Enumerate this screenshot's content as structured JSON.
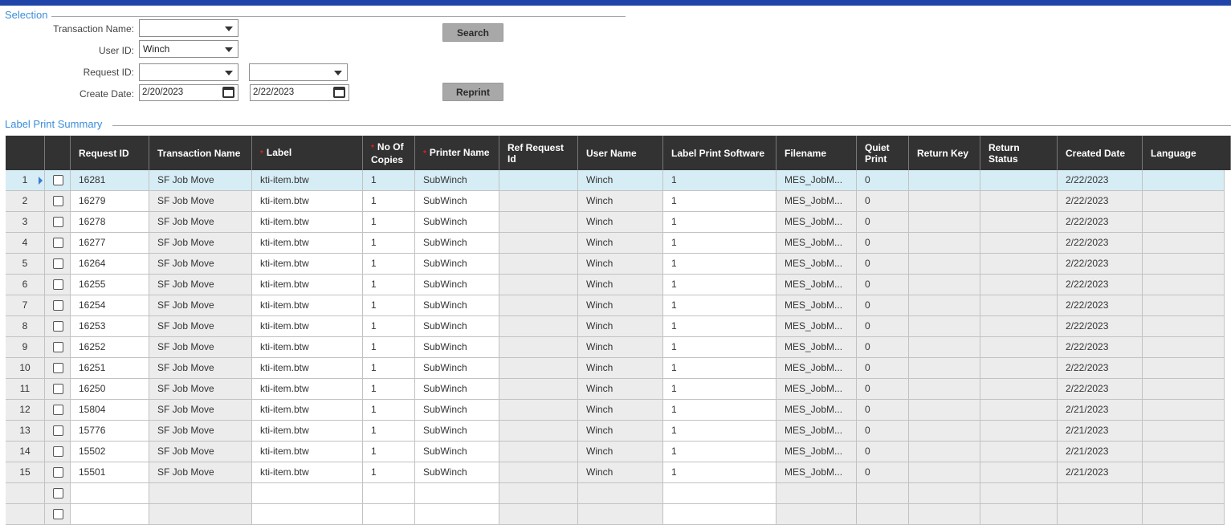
{
  "selection": {
    "title": "Selection",
    "transaction_name_label": "Transaction Name:",
    "transaction_name_value": "",
    "user_id_label": "User ID:",
    "user_id_value": "Winch",
    "request_id_label": "Request ID:",
    "request_id_from": "",
    "request_id_to": "",
    "create_date_label": "Create Date:",
    "create_date_from": "2/20/2023",
    "create_date_to": "2/22/2023",
    "search_label": "Search",
    "reprint_label": "Reprint"
  },
  "summary": {
    "title": "Label Print Summary",
    "columns": [
      {
        "label": ""
      },
      {
        "label": ""
      },
      {
        "label": "Request ID"
      },
      {
        "label": "Transaction Name"
      },
      {
        "label": "Label",
        "required": true
      },
      {
        "label": "No Of Copies",
        "required": true
      },
      {
        "label": "Printer Name",
        "required": true
      },
      {
        "label": "Ref Request Id"
      },
      {
        "label": "User Name"
      },
      {
        "label": "Label Print Software"
      },
      {
        "label": "Filename"
      },
      {
        "label": "Quiet Print"
      },
      {
        "label": "Return Key"
      },
      {
        "label": "Return Status"
      },
      {
        "label": "Created Date"
      },
      {
        "label": "Language"
      }
    ],
    "rows": [
      {
        "n": "1",
        "request_id": "16281",
        "transaction": "SF Job Move",
        "label": "kti-item.btw",
        "copies": "1",
        "printer": "SubWinch",
        "ref": "",
        "user": "Winch",
        "software": "1",
        "filename": "MES_JobM...",
        "quiet": "0",
        "return_key": "",
        "return_status": "",
        "created": "2/22/2023",
        "language": ""
      },
      {
        "n": "2",
        "request_id": "16279",
        "transaction": "SF Job Move",
        "label": "kti-item.btw",
        "copies": "1",
        "printer": "SubWinch",
        "ref": "",
        "user": "Winch",
        "software": "1",
        "filename": "MES_JobM...",
        "quiet": "0",
        "return_key": "",
        "return_status": "",
        "created": "2/22/2023",
        "language": ""
      },
      {
        "n": "3",
        "request_id": "16278",
        "transaction": "SF Job Move",
        "label": "kti-item.btw",
        "copies": "1",
        "printer": "SubWinch",
        "ref": "",
        "user": "Winch",
        "software": "1",
        "filename": "MES_JobM...",
        "quiet": "0",
        "return_key": "",
        "return_status": "",
        "created": "2/22/2023",
        "language": ""
      },
      {
        "n": "4",
        "request_id": "16277",
        "transaction": "SF Job Move",
        "label": "kti-item.btw",
        "copies": "1",
        "printer": "SubWinch",
        "ref": "",
        "user": "Winch",
        "software": "1",
        "filename": "MES_JobM...",
        "quiet": "0",
        "return_key": "",
        "return_status": "",
        "created": "2/22/2023",
        "language": ""
      },
      {
        "n": "5",
        "request_id": "16264",
        "transaction": "SF Job Move",
        "label": "kti-item.btw",
        "copies": "1",
        "printer": "SubWinch",
        "ref": "",
        "user": "Winch",
        "software": "1",
        "filename": "MES_JobM...",
        "quiet": "0",
        "return_key": "",
        "return_status": "",
        "created": "2/22/2023",
        "language": ""
      },
      {
        "n": "6",
        "request_id": "16255",
        "transaction": "SF Job Move",
        "label": "kti-item.btw",
        "copies": "1",
        "printer": "SubWinch",
        "ref": "",
        "user": "Winch",
        "software": "1",
        "filename": "MES_JobM...",
        "quiet": "0",
        "return_key": "",
        "return_status": "",
        "created": "2/22/2023",
        "language": ""
      },
      {
        "n": "7",
        "request_id": "16254",
        "transaction": "SF Job Move",
        "label": "kti-item.btw",
        "copies": "1",
        "printer": "SubWinch",
        "ref": "",
        "user": "Winch",
        "software": "1",
        "filename": "MES_JobM...",
        "quiet": "0",
        "return_key": "",
        "return_status": "",
        "created": "2/22/2023",
        "language": ""
      },
      {
        "n": "8",
        "request_id": "16253",
        "transaction": "SF Job Move",
        "label": "kti-item.btw",
        "copies": "1",
        "printer": "SubWinch",
        "ref": "",
        "user": "Winch",
        "software": "1",
        "filename": "MES_JobM...",
        "quiet": "0",
        "return_key": "",
        "return_status": "",
        "created": "2/22/2023",
        "language": ""
      },
      {
        "n": "9",
        "request_id": "16252",
        "transaction": "SF Job Move",
        "label": "kti-item.btw",
        "copies": "1",
        "printer": "SubWinch",
        "ref": "",
        "user": "Winch",
        "software": "1",
        "filename": "MES_JobM...",
        "quiet": "0",
        "return_key": "",
        "return_status": "",
        "created": "2/22/2023",
        "language": ""
      },
      {
        "n": "10",
        "request_id": "16251",
        "transaction": "SF Job Move",
        "label": "kti-item.btw",
        "copies": "1",
        "printer": "SubWinch",
        "ref": "",
        "user": "Winch",
        "software": "1",
        "filename": "MES_JobM...",
        "quiet": "0",
        "return_key": "",
        "return_status": "",
        "created": "2/22/2023",
        "language": ""
      },
      {
        "n": "11",
        "request_id": "16250",
        "transaction": "SF Job Move",
        "label": "kti-item.btw",
        "copies": "1",
        "printer": "SubWinch",
        "ref": "",
        "user": "Winch",
        "software": "1",
        "filename": "MES_JobM...",
        "quiet": "0",
        "return_key": "",
        "return_status": "",
        "created": "2/22/2023",
        "language": ""
      },
      {
        "n": "12",
        "request_id": "15804",
        "transaction": "SF Job Move",
        "label": "kti-item.btw",
        "copies": "1",
        "printer": "SubWinch",
        "ref": "",
        "user": "Winch",
        "software": "1",
        "filename": "MES_JobM...",
        "quiet": "0",
        "return_key": "",
        "return_status": "",
        "created": "2/21/2023",
        "language": ""
      },
      {
        "n": "13",
        "request_id": "15776",
        "transaction": "SF Job Move",
        "label": "kti-item.btw",
        "copies": "1",
        "printer": "SubWinch",
        "ref": "",
        "user": "Winch",
        "software": "1",
        "filename": "MES_JobM...",
        "quiet": "0",
        "return_key": "",
        "return_status": "",
        "created": "2/21/2023",
        "language": ""
      },
      {
        "n": "14",
        "request_id": "15502",
        "transaction": "SF Job Move",
        "label": "kti-item.btw",
        "copies": "1",
        "printer": "SubWinch",
        "ref": "",
        "user": "Winch",
        "software": "1",
        "filename": "MES_JobM...",
        "quiet": "0",
        "return_key": "",
        "return_status": "",
        "created": "2/21/2023",
        "language": ""
      },
      {
        "n": "15",
        "request_id": "15501",
        "transaction": "SF Job Move",
        "label": "kti-item.btw",
        "copies": "1",
        "printer": "SubWinch",
        "ref": "",
        "user": "Winch",
        "software": "1",
        "filename": "MES_JobM...",
        "quiet": "0",
        "return_key": "",
        "return_status": "",
        "created": "2/21/2023",
        "language": ""
      }
    ],
    "selected_row": 0
  },
  "colors": {
    "top_bar": "#1f45a8",
    "section_title": "#3a8ddb",
    "header_bg": "#323232",
    "row_bg": "#ececec",
    "selected_row_bg": "#d6edf5",
    "required_marker": "#e02020"
  }
}
